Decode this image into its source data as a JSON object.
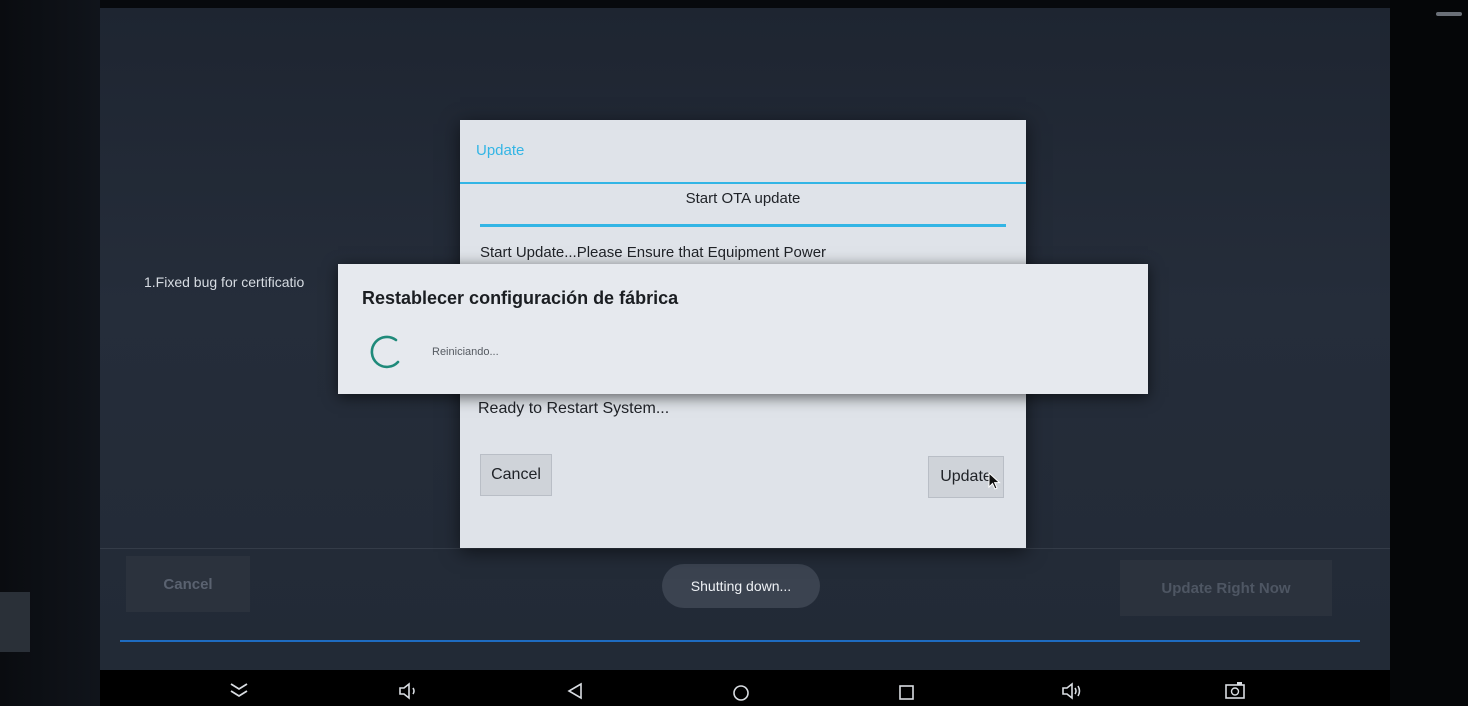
{
  "background_app": {
    "note": "1.Fixed bug for certificatio",
    "cancel_label": "Cancel",
    "update_now_label": "Update Right Now"
  },
  "toast": {
    "text": "Shutting down..."
  },
  "ota_dialog": {
    "title": "Update",
    "subtitle": "Start OTA update",
    "message": "Start Update...Please Ensure that Equipment Power",
    "status": "Ready to Restart System...",
    "cancel_label": "Cancel",
    "update_label": "Update"
  },
  "reset_dialog": {
    "title": "Restablecer configuración de fábrica",
    "message": "Reiniciando..."
  },
  "colors": {
    "accent": "#33b5e5",
    "spinner": "#1f8a7a",
    "progress_line": "#1e6bc0"
  },
  "navbar": {
    "icons": [
      "hide-bar-icon",
      "volume-down-icon",
      "back-icon",
      "home-icon",
      "recents-icon",
      "volume-up-icon",
      "screenshot-icon"
    ]
  }
}
